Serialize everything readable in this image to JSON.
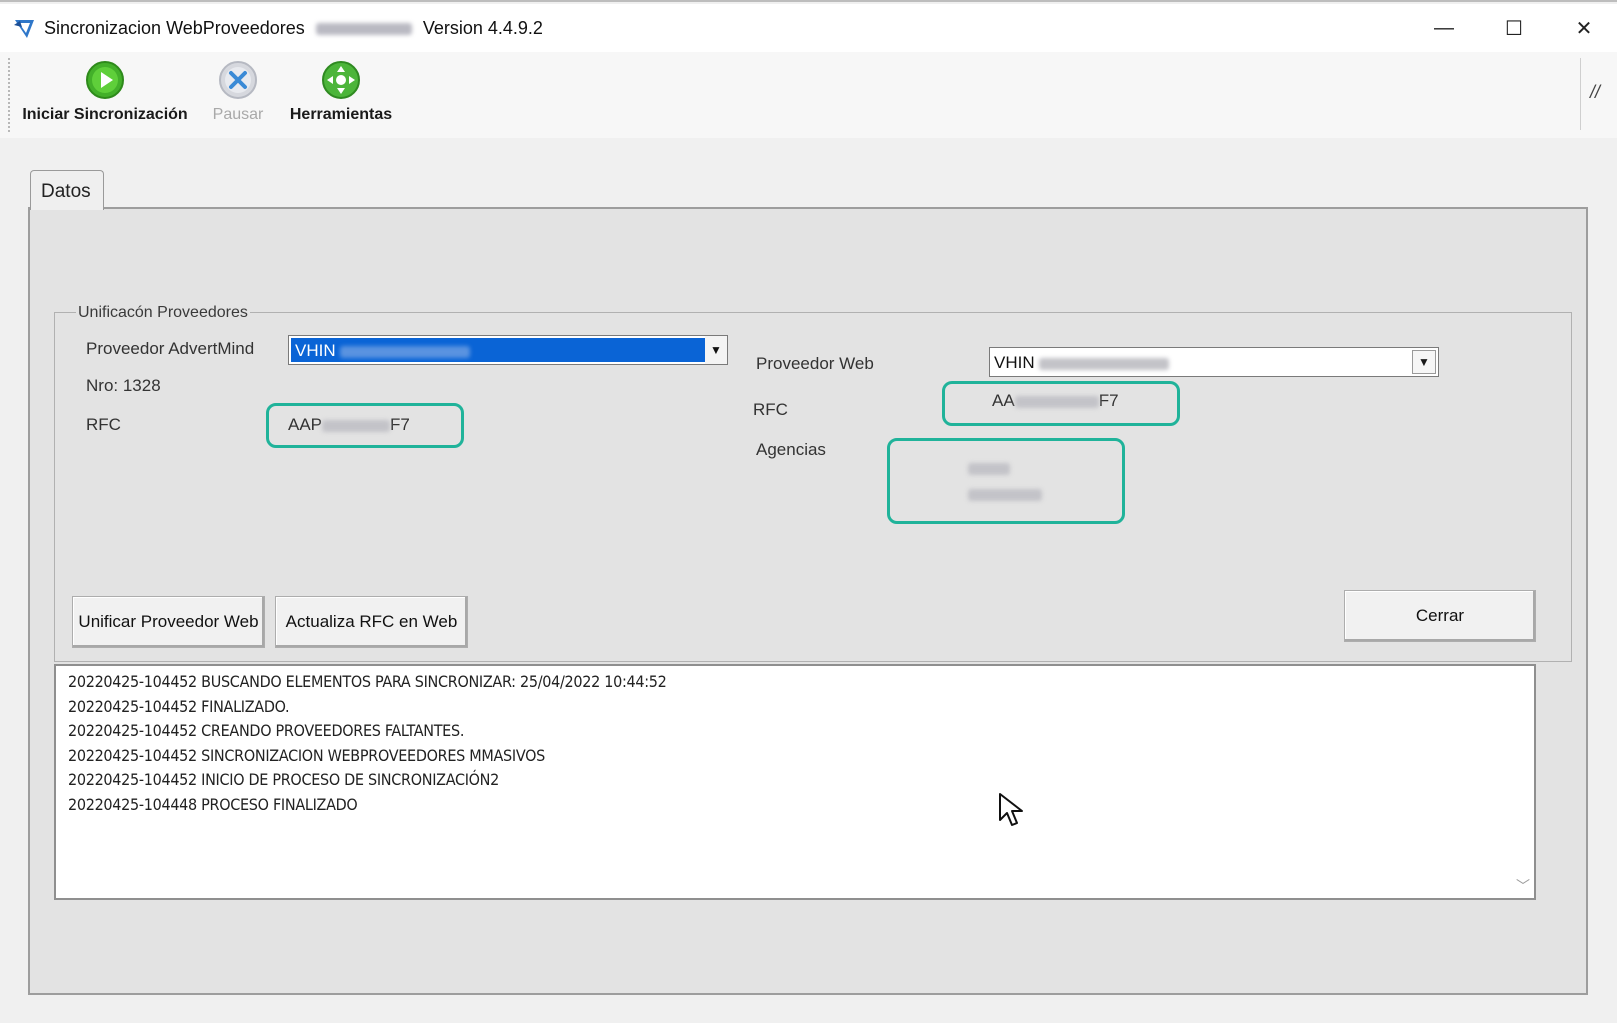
{
  "window": {
    "title_prefix": "Sincronizacion WebProveedores",
    "title_suffix": "Version 4.4.9.2",
    "controls": {
      "minimize": "—",
      "maximize": "☐",
      "close": "✕"
    }
  },
  "toolbar": {
    "start_label": "Iniciar Sincronización",
    "pause_label": "Pausar",
    "tools_label": "Herramientas",
    "corner_mark": "//"
  },
  "tabs": [
    {
      "label": "Datos",
      "active": true
    }
  ],
  "unify": {
    "group_title": "Unificacón Proveedores",
    "advertmind_label": "Proveedor AdvertMind",
    "advertmind_selected": "VHIN",
    "nro_label": "Nro: 1328",
    "rfc_label": "RFC",
    "rfc_left_prefix": "AAP",
    "rfc_left_suffix": "F7",
    "web_label": "Proveedor Web",
    "web_selected": "VHIN",
    "rfc_right_label": "RFC",
    "rfc_right_prefix": "AA",
    "rfc_right_suffix": "F7",
    "agencias_label": "Agencias",
    "buttons": {
      "unify": "Unificar Proveedor Web",
      "update_rfc": "Actualiza  RFC en Web",
      "close": "Cerrar"
    }
  },
  "log": {
    "lines": [
      "20220425-104452 BUSCANDO ELEMENTOS PARA SINCRONIZAR: 25/04/2022 10:44:52",
      "20220425-104452 FINALIZADO.",
      "20220425-104452 CREANDO PROVEEDORES FALTANTES.",
      "20220425-104452 SINCRONIZACION WEBPROVEEDORES MMASIVOS",
      "20220425-104452 INICIO DE PROCESO DE SINCRONIZACIÓN2",
      "20220425-104448 PROCESO FINALIZADO"
    ]
  },
  "colors": {
    "highlight": "#20b39a",
    "selection": "#0a64d6"
  },
  "icons": {
    "app": "app-logo-icon",
    "start": "play-icon",
    "pause": "cancel-x-icon",
    "tools": "tools-icon",
    "cursor": "mouse-pointer-icon"
  }
}
